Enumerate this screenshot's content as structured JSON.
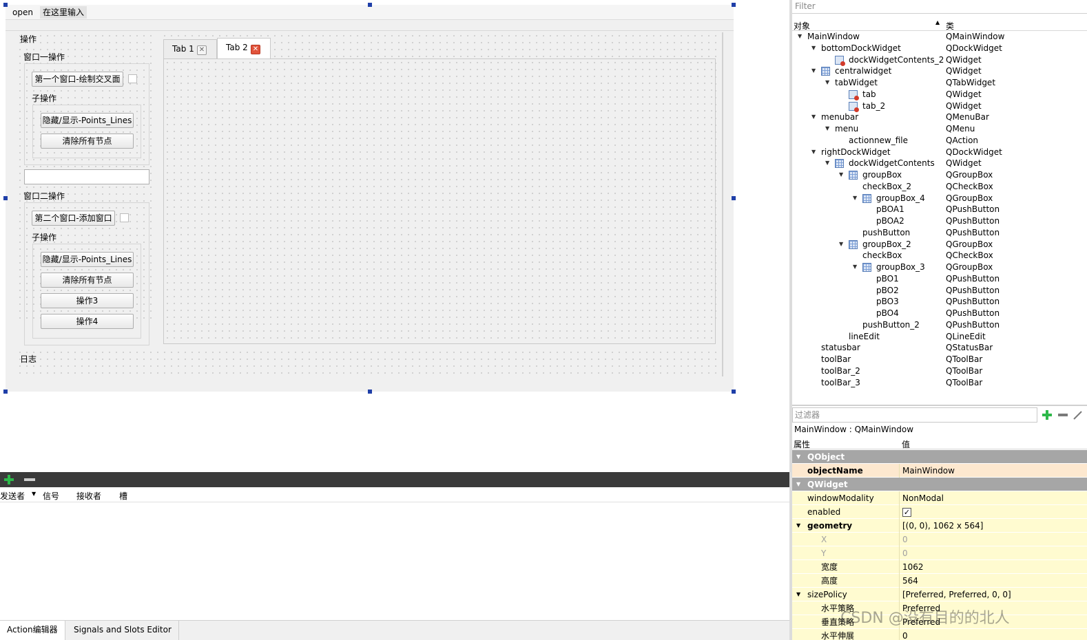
{
  "form": {
    "menubar": {
      "items": [
        "open",
        "在这里输入"
      ]
    },
    "left_dock_title": "操作",
    "group1": {
      "title": "窗口一操作",
      "main_button": "第一个窗口-绘制交叉面",
      "sub_title": "子操作",
      "sub_buttons": [
        "隐藏/显示-Points_Lines",
        "清除所有节点"
      ]
    },
    "group2": {
      "title": "窗口二操作",
      "main_button": "第二个窗口-添加窗口",
      "sub_title": "子操作",
      "sub_buttons": [
        "隐藏/显示-Points_Lines",
        "清除所有节点",
        "操作3",
        "操作4"
      ]
    },
    "tabs": [
      "Tab 1",
      "Tab 2"
    ],
    "log_title": "日志"
  },
  "connections": {
    "add_icon": "plus-icon",
    "remove_icon": "minus-icon",
    "columns": [
      "发送者",
      "信号",
      "接收者",
      "槽"
    ],
    "bottom_tabs": [
      "Action编辑器",
      "Signals and Slots Editor"
    ]
  },
  "object_inspector": {
    "filter_placeholder": "Filter",
    "col_object": "对象",
    "col_class": "类",
    "rows": [
      {
        "name": "MainWindow",
        "cls": "QMainWindow",
        "level": 0,
        "expand": true,
        "icon": ""
      },
      {
        "name": "bottomDockWidget",
        "cls": "QDockWidget",
        "level": 1,
        "expand": true,
        "icon": ""
      },
      {
        "name": "dockWidgetContents_2",
        "cls": "QWidget",
        "level": 2,
        "expand": false,
        "icon": "widget"
      },
      {
        "name": "centralwidget",
        "cls": "QWidget",
        "level": 1,
        "expand": true,
        "icon": "grid"
      },
      {
        "name": "tabWidget",
        "cls": "QTabWidget",
        "level": 2,
        "expand": true,
        "icon": ""
      },
      {
        "name": "tab",
        "cls": "QWidget",
        "level": 3,
        "expand": false,
        "icon": "widget"
      },
      {
        "name": "tab_2",
        "cls": "QWidget",
        "level": 3,
        "expand": false,
        "icon": "widget"
      },
      {
        "name": "menubar",
        "cls": "QMenuBar",
        "level": 1,
        "expand": true,
        "icon": ""
      },
      {
        "name": "menu",
        "cls": "QMenu",
        "level": 2,
        "expand": true,
        "icon": ""
      },
      {
        "name": "actionnew_file",
        "cls": "QAction",
        "level": 3,
        "expand": false,
        "icon": ""
      },
      {
        "name": "rightDockWidget",
        "cls": "QDockWidget",
        "level": 1,
        "expand": true,
        "icon": ""
      },
      {
        "name": "dockWidgetContents",
        "cls": "QWidget",
        "level": 2,
        "expand": true,
        "icon": "grid"
      },
      {
        "name": "groupBox",
        "cls": "QGroupBox",
        "level": 3,
        "expand": true,
        "icon": "grid"
      },
      {
        "name": "checkBox_2",
        "cls": "QCheckBox",
        "level": 4,
        "expand": false,
        "icon": ""
      },
      {
        "name": "groupBox_4",
        "cls": "QGroupBox",
        "level": 4,
        "expand": true,
        "icon": "grid"
      },
      {
        "name": "pBOA1",
        "cls": "QPushButton",
        "level": 5,
        "expand": false,
        "icon": ""
      },
      {
        "name": "pBOA2",
        "cls": "QPushButton",
        "level": 5,
        "expand": false,
        "icon": ""
      },
      {
        "name": "pushButton",
        "cls": "QPushButton",
        "level": 4,
        "expand": false,
        "icon": ""
      },
      {
        "name": "groupBox_2",
        "cls": "QGroupBox",
        "level": 3,
        "expand": true,
        "icon": "grid"
      },
      {
        "name": "checkBox",
        "cls": "QCheckBox",
        "level": 4,
        "expand": false,
        "icon": ""
      },
      {
        "name": "groupBox_3",
        "cls": "QGroupBox",
        "level": 4,
        "expand": true,
        "icon": "grid"
      },
      {
        "name": "pBO1",
        "cls": "QPushButton",
        "level": 5,
        "expand": false,
        "icon": ""
      },
      {
        "name": "pBO2",
        "cls": "QPushButton",
        "level": 5,
        "expand": false,
        "icon": ""
      },
      {
        "name": "pBO3",
        "cls": "QPushButton",
        "level": 5,
        "expand": false,
        "icon": ""
      },
      {
        "name": "pBO4",
        "cls": "QPushButton",
        "level": 5,
        "expand": false,
        "icon": ""
      },
      {
        "name": "pushButton_2",
        "cls": "QPushButton",
        "level": 4,
        "expand": false,
        "icon": ""
      },
      {
        "name": "lineEdit",
        "cls": "QLineEdit",
        "level": 3,
        "expand": false,
        "icon": ""
      },
      {
        "name": "statusbar",
        "cls": "QStatusBar",
        "level": 1,
        "expand": false,
        "icon": ""
      },
      {
        "name": "toolBar",
        "cls": "QToolBar",
        "level": 1,
        "expand": false,
        "icon": ""
      },
      {
        "name": "toolBar_2",
        "cls": "QToolBar",
        "level": 1,
        "expand": false,
        "icon": ""
      },
      {
        "name": "toolBar_3",
        "cls": "QToolBar",
        "level": 1,
        "expand": false,
        "icon": ""
      }
    ]
  },
  "property_editor": {
    "filter_placeholder": "过滤器",
    "add_icon": "plus-icon",
    "remove_icon": "minus-icon",
    "title": "MainWindow : QMainWindow",
    "col_property": "属性",
    "col_value": "值",
    "rows": [
      {
        "type": "section",
        "name": "QObject"
      },
      {
        "type": "prop",
        "name": "objectName",
        "value": "MainWindow",
        "bold": true,
        "tint": "orange"
      },
      {
        "type": "section",
        "name": "QWidget"
      },
      {
        "type": "prop",
        "name": "windowModality",
        "value": "NonModal"
      },
      {
        "type": "prop",
        "name": "enabled",
        "value": "✓",
        "check": true
      },
      {
        "type": "prop",
        "name": "geometry",
        "value": "[(0, 0), 1062 x 564]",
        "bold": true,
        "expand": true
      },
      {
        "type": "sub",
        "name": "X",
        "value": "0",
        "dim": true
      },
      {
        "type": "sub",
        "name": "Y",
        "value": "0",
        "dim": true
      },
      {
        "type": "sub",
        "name": "宽度",
        "value": "1062"
      },
      {
        "type": "sub",
        "name": "高度",
        "value": "564"
      },
      {
        "type": "prop",
        "name": "sizePolicy",
        "value": "[Preferred, Preferred, 0, 0]",
        "expand": true
      },
      {
        "type": "sub",
        "name": "水平策略",
        "value": "Preferred"
      },
      {
        "type": "sub",
        "name": "垂直策略",
        "value": "Preferred"
      },
      {
        "type": "sub",
        "name": "水平伸展",
        "value": "0"
      }
    ]
  },
  "watermark": "CSDN @没有目的的北人",
  "colors": {
    "selection_handle": "#1f3fa8",
    "section_header": "#a6a6a6",
    "prop_yellow": "#fffbd0",
    "prop_orange": "#fde8cf",
    "plus_green": "#2db84a",
    "close_hot": "#e1533b"
  }
}
